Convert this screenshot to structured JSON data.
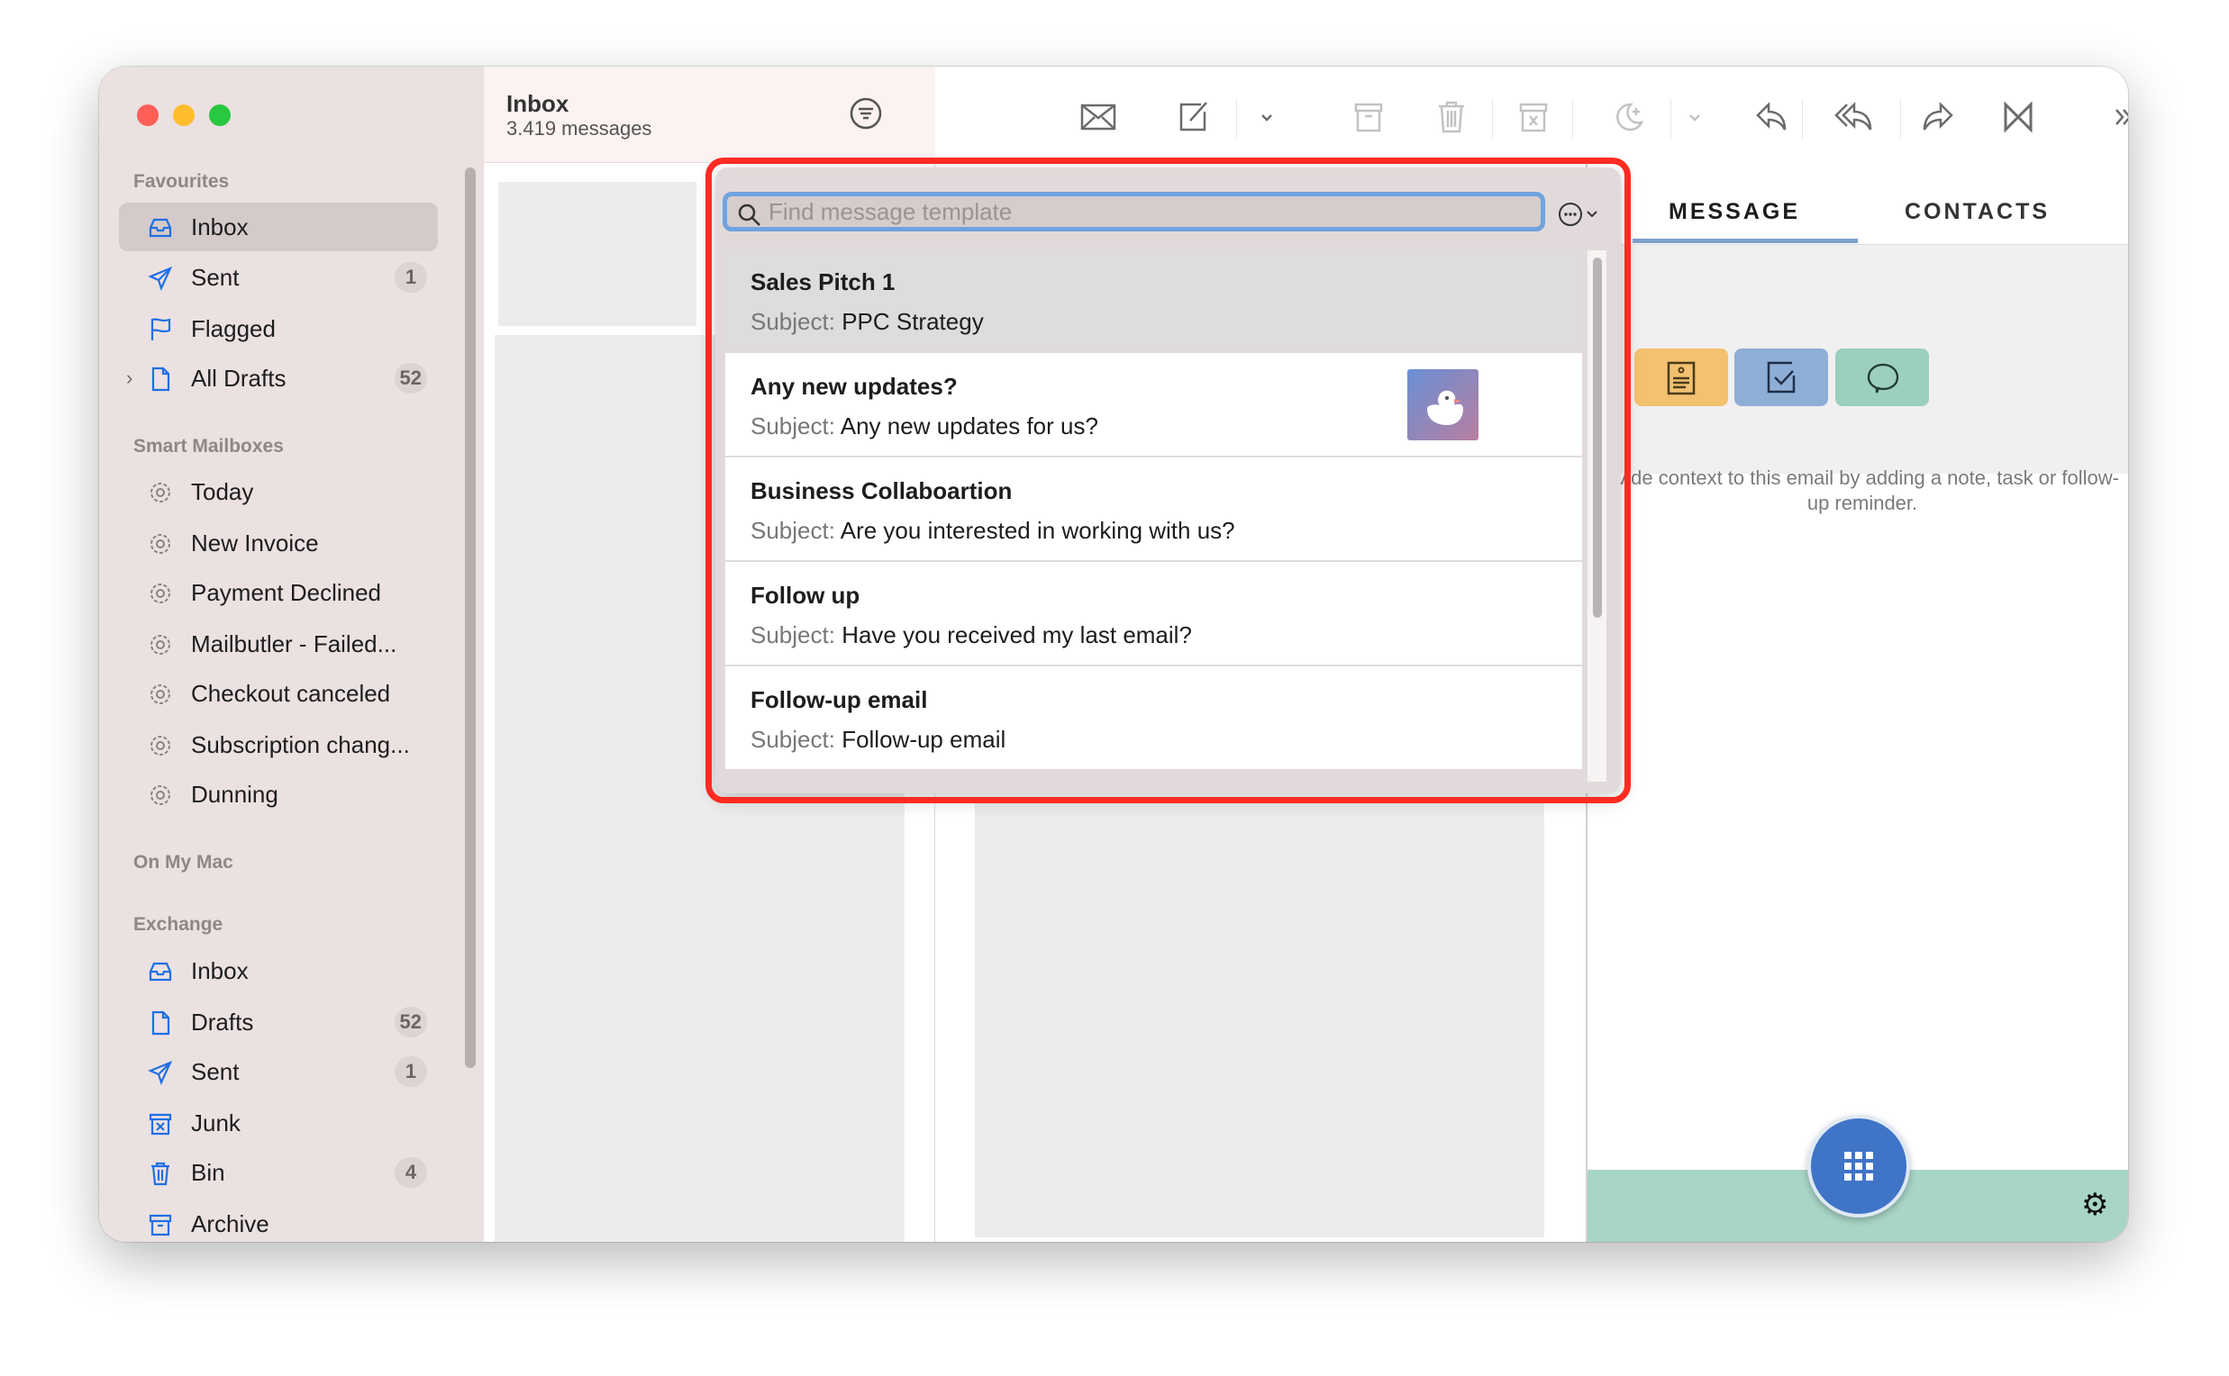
{
  "sidebar": {
    "favourites_header": "Favourites",
    "favourites": [
      {
        "label": "Inbox",
        "icon": "inbox-icon",
        "badge": null,
        "selected": true
      },
      {
        "label": "Sent",
        "icon": "paperplane-icon",
        "badge": "1"
      },
      {
        "label": "Flagged",
        "icon": "flag-icon",
        "badge": null
      },
      {
        "label": "All Drafts",
        "icon": "document-icon",
        "badge": "52",
        "expandable": true
      }
    ],
    "smart_header": "Smart Mailboxes",
    "smart": [
      {
        "label": "Today"
      },
      {
        "label": "New Invoice"
      },
      {
        "label": "Payment Declined"
      },
      {
        "label": "Mailbutler - Failed..."
      },
      {
        "label": "Checkout canceled"
      },
      {
        "label": "Subscription chang..."
      },
      {
        "label": "Dunning"
      }
    ],
    "onmymac_header": "On My Mac",
    "exchange_header": "Exchange",
    "exchange": [
      {
        "label": "Inbox",
        "icon": "inbox-icon",
        "badge": null
      },
      {
        "label": "Drafts",
        "icon": "document-icon",
        "badge": "52"
      },
      {
        "label": "Sent",
        "icon": "paperplane-icon",
        "badge": "1"
      },
      {
        "label": "Junk",
        "icon": "junk-icon",
        "badge": null
      },
      {
        "label": "Bin",
        "icon": "trash-icon",
        "badge": "4"
      },
      {
        "label": "Archive",
        "icon": "archive-icon",
        "badge": null
      }
    ]
  },
  "list": {
    "title": "Inbox",
    "count": "3.419 messages"
  },
  "toolbar": [
    "envelope-icon",
    "compose-icon",
    "chevron-down-icon",
    "archive-icon",
    "trash-icon",
    "junk-icon",
    "snooze-icon",
    "chevron-down-icon",
    "reply-icon",
    "reply-all-icon",
    "forward-icon",
    "mailbutler-icon",
    "more-icon",
    "search-icon"
  ],
  "right": {
    "tabs": [
      {
        "label": "MESSAGE",
        "active": true
      },
      {
        "label": "CONTACTS",
        "active": false
      }
    ],
    "hint": "ovide context to this email by adding a note, task or follow-up reminder.",
    "actions": [
      {
        "icon": "note-icon",
        "color": "#f3c16f"
      },
      {
        "icon": "task-icon",
        "color": "#8eaed6"
      },
      {
        "icon": "comment-icon",
        "color": "#9bcfbe"
      }
    ],
    "footer_color": "#a8d5c6",
    "fab_color": "#3f74c7"
  },
  "popup": {
    "search_placeholder": "Find message template",
    "subject_label": "Subject:",
    "templates": [
      {
        "title": "Sales Pitch 1",
        "subject": "PPC Strategy",
        "selected": true
      },
      {
        "title": "Any new updates?",
        "subject": "Any new updates for us?",
        "thumbnail": "duck-icon"
      },
      {
        "title": "Business Collaboartion",
        "subject": "Are you interested in working with us?"
      },
      {
        "title": "Follow up",
        "subject": "Have you received my last email?"
      },
      {
        "title": "Follow-up email",
        "subject": "Follow-up email"
      }
    ]
  },
  "highlight_color": "#ff2b22"
}
